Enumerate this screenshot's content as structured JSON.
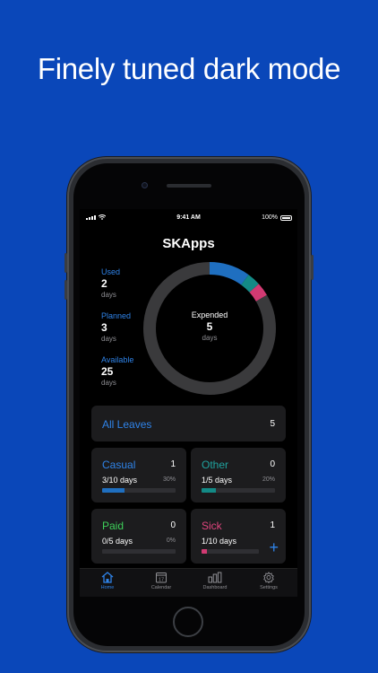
{
  "headline": "Finely tuned dark mode",
  "status_bar": {
    "time": "9:41 AM",
    "battery": "100%"
  },
  "app_title": "SKApps",
  "stats": [
    {
      "label": "Used",
      "value": "2",
      "unit": "days"
    },
    {
      "label": "Planned",
      "value": "3",
      "unit": "days"
    },
    {
      "label": "Available",
      "value": "25",
      "unit": "days"
    }
  ],
  "donut": {
    "center_label": "Expended",
    "center_value": "5",
    "center_unit": "days",
    "segments": [
      {
        "name": "Casual",
        "fraction": 0.1,
        "color": "#1f6fc0"
      },
      {
        "name": "Other",
        "fraction": 0.033,
        "color": "#138a86"
      },
      {
        "name": "Sick",
        "fraction": 0.033,
        "color": "#d13a72"
      },
      {
        "name": "Remaining",
        "fraction": 0.834,
        "color": "#3a3a3c"
      }
    ]
  },
  "all_leaves": {
    "label": "All Leaves",
    "count": "5"
  },
  "cards": [
    {
      "name": "Casual",
      "count": "1",
      "days": "3/10 days",
      "percent": "30%",
      "progress": 0.3,
      "name_color": "#2f83e8",
      "bar_color": "#1f6fc0"
    },
    {
      "name": "Other",
      "count": "0",
      "days": "1/5 days",
      "percent": "20%",
      "progress": 0.2,
      "name_color": "#1fa39f",
      "bar_color": "#138a86"
    },
    {
      "name": "Paid",
      "count": "0",
      "days": "0/5 days",
      "percent": "0%",
      "progress": 0.0,
      "name_color": "#3ed05a",
      "bar_color": "#3ed05a"
    },
    {
      "name": "Sick",
      "count": "1",
      "days": "1/10 days",
      "percent": "",
      "progress": 0.1,
      "name_color": "#e0457e",
      "bar_color": "#d13a72"
    }
  ],
  "add_icon": "plus-icon",
  "tabs": [
    {
      "label": "Home",
      "icon": "home-icon",
      "active": true
    },
    {
      "label": "Calendar",
      "icon": "calendar-icon",
      "active": false,
      "badge": "17"
    },
    {
      "label": "Dashboard",
      "icon": "bar-chart-icon",
      "active": false
    },
    {
      "label": "Settings",
      "icon": "gear-icon",
      "active": false
    }
  ]
}
